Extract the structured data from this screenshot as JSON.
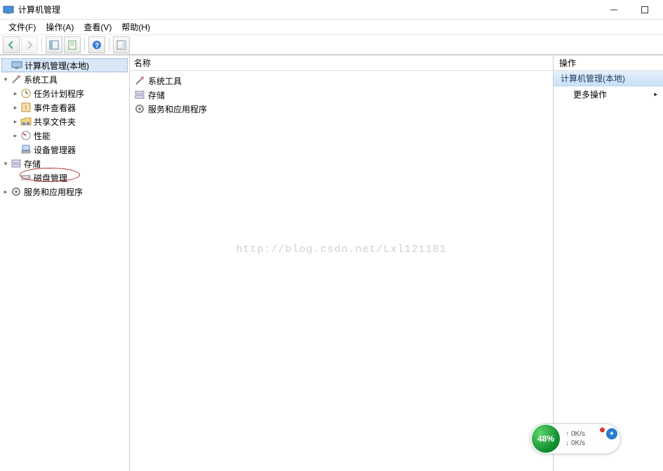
{
  "title": "计算机管理",
  "menubar": {
    "file": "文件(F)",
    "action": "操作(A)",
    "view": "查看(V)",
    "help": "帮助(H)"
  },
  "tree": {
    "root": "计算机管理(本地)",
    "system_tools": "系统工具",
    "task_scheduler": "任务计划程序",
    "event_viewer": "事件查看器",
    "shared_folders": "共享文件夹",
    "performance": "性能",
    "device_manager": "设备管理器",
    "storage": "存储",
    "disk_management": "磁盘管理",
    "services_apps": "服务和应用程序"
  },
  "center": {
    "header": "名称",
    "items": {
      "system_tools": "系统工具",
      "storage": "存储",
      "services_apps": "服务和应用程序"
    }
  },
  "actions": {
    "header": "操作",
    "selected": "计算机管理(本地)",
    "more": "更多操作"
  },
  "watermark": "http://blog.csdn.net/Lxl121181",
  "floater": {
    "percent": "48%",
    "up_speed": "0K/s",
    "down_speed": "0K/s"
  }
}
